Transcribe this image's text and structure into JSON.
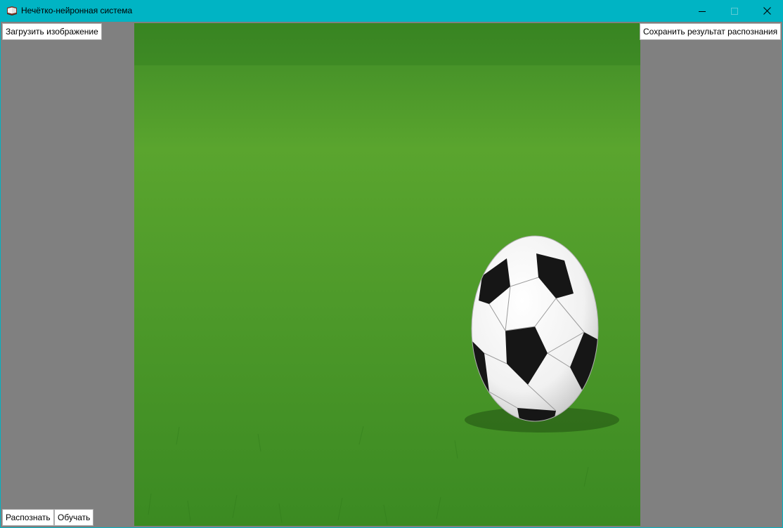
{
  "window": {
    "title": "Нечётко-нейронная система"
  },
  "buttons": {
    "load_image": "Загрузить изображение",
    "save_result": "Сохранить результат распознания",
    "recognize": "Распознать",
    "train": "Обучать"
  },
  "colors": {
    "titlebar": "#00b4c4",
    "client_background": "#808080",
    "button_background": "#ffffff"
  },
  "image": {
    "subject": "soccer ball on grass"
  }
}
